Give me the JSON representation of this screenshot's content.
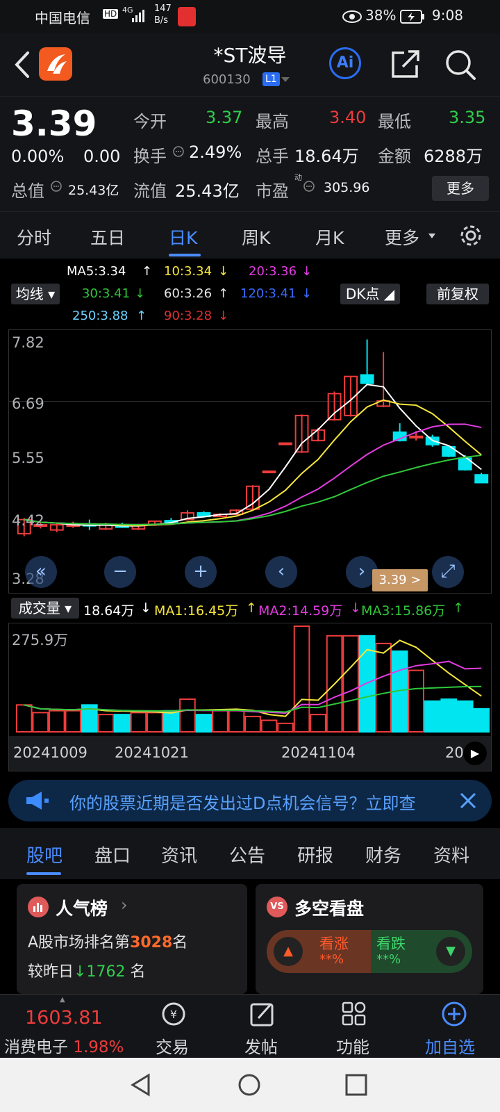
{
  "status_bar": {
    "carrier": "中国电信",
    "hd": "HD",
    "signal": "4G",
    "speed_value": "147",
    "speed_unit": "B/s",
    "battery": "38%",
    "time": "9:08"
  },
  "header": {
    "title": "*ST波导",
    "code": "600130",
    "level": "L1"
  },
  "quote": {
    "price": "3.39",
    "change_pct": "0.00%",
    "change": "0.00",
    "open_label": "今开",
    "open": "3.37",
    "high_label": "最高",
    "high": "3.40",
    "low_label": "最低",
    "low": "3.35",
    "turnover_label": "换手",
    "turnover": "2.49%",
    "volume_label": "总手",
    "volume": "18.64万",
    "amount_label": "金额",
    "amount": "6288万",
    "mcap_label": "总值",
    "mcap": "25.43亿",
    "float_label": "流值",
    "float": "25.43亿",
    "pe_label": "市盈",
    "pe_sup": "动",
    "pe": "305.96",
    "more": "更多"
  },
  "tabs": [
    "分时",
    "五日",
    "日K",
    "周K",
    "月K",
    "更多"
  ],
  "active_tab": 2,
  "ma_legend": {
    "ma5": "MA5:3.34",
    "ma10": "10:3.34",
    "ma20": "20:3.36",
    "ma30": "30:3.41",
    "ma60": "60:3.26",
    "ma120": "120:3.41",
    "ma250": "250:3.88",
    "ma90": "90:3.28",
    "ma_btn": "均线",
    "dk_btn": "DK点",
    "adj_btn": "前复权"
  },
  "colors": {
    "up": "#ee3c3c",
    "down": "#00e5f0",
    "ma5": "#ffffff",
    "ma10": "#f6e63c",
    "ma20": "#e23ce0",
    "ma30": "#30c73a",
    "ma60": "#e6e6e6",
    "ma120": "#3a6cff",
    "ma250": "#6ad1ff",
    "ma90": "#e03030"
  },
  "chart": {
    "y_labels": [
      "7.82",
      "6.69",
      "5.55",
      "4.42",
      "3.28"
    ],
    "last_price_tag": "3.39 >"
  },
  "chart_data": {
    "type": "candlestick",
    "ylim": [
      3.28,
      7.82
    ],
    "candles": [
      {
        "o": 4.15,
        "c": 4.42,
        "h": 4.45,
        "l": 4.1
      },
      {
        "o": 4.3,
        "c": 4.32,
        "h": 4.38,
        "l": 4.25
      },
      {
        "o": 4.22,
        "c": 4.32,
        "h": 4.35,
        "l": 4.18
      },
      {
        "o": 4.3,
        "c": 4.32,
        "h": 4.38,
        "l": 4.26
      },
      {
        "o": 4.33,
        "c": 4.3,
        "h": 4.42,
        "l": 4.22
      },
      {
        "o": 4.24,
        "c": 4.32,
        "h": 4.36,
        "l": 4.22
      },
      {
        "o": 4.3,
        "c": 4.28,
        "h": 4.36,
        "l": 4.26
      },
      {
        "o": 4.24,
        "c": 4.3,
        "h": 4.34,
        "l": 4.22
      },
      {
        "o": 4.32,
        "c": 4.39,
        "h": 4.4,
        "l": 4.3
      },
      {
        "o": 4.4,
        "c": 4.39,
        "h": 4.45,
        "l": 4.36
      },
      {
        "o": 4.42,
        "c": 4.55,
        "h": 4.6,
        "l": 4.4
      },
      {
        "o": 4.55,
        "c": 4.48,
        "h": 4.58,
        "l": 4.46
      },
      {
        "o": 4.48,
        "c": 4.52,
        "h": 4.54,
        "l": 4.47
      },
      {
        "o": 4.52,
        "c": 4.6,
        "h": 4.62,
        "l": 4.51
      },
      {
        "o": 4.62,
        "c": 5.06,
        "h": 5.08,
        "l": 4.6
      },
      {
        "o": 5.35,
        "c": 5.35,
        "h": 5.36,
        "l": 5.34
      },
      {
        "o": 5.89,
        "c": 5.89,
        "h": 5.9,
        "l": 5.88
      },
      {
        "o": 5.72,
        "c": 6.42,
        "h": 6.44,
        "l": 5.7
      },
      {
        "o": 5.94,
        "c": 6.14,
        "h": 6.18,
        "l": 5.92
      },
      {
        "o": 6.34,
        "c": 6.84,
        "h": 6.88,
        "l": 6.32
      },
      {
        "o": 6.42,
        "c": 7.17,
        "h": 7.18,
        "l": 6.4
      },
      {
        "o": 7.2,
        "c": 7.04,
        "h": 7.88,
        "l": 7.0
      },
      {
        "o": 6.6,
        "c": 6.7,
        "h": 7.64,
        "l": 6.58
      },
      {
        "o": 6.1,
        "c": 5.94,
        "h": 6.27,
        "l": 5.92
      },
      {
        "o": 6.0,
        "c": 6.02,
        "h": 6.12,
        "l": 5.94
      },
      {
        "o": 6.0,
        "c": 5.86,
        "h": 6.05,
        "l": 5.82
      },
      {
        "o": 5.82,
        "c": 5.64,
        "h": 5.84,
        "l": 5.62
      },
      {
        "o": 5.6,
        "c": 5.38,
        "h": 5.66,
        "l": 5.36
      },
      {
        "o": 5.28,
        "c": 5.13,
        "h": 5.32,
        "l": 5.12
      }
    ],
    "volume_max_label": "275.9万",
    "volumes": [
      70,
      50,
      55,
      55,
      70,
      45,
      45,
      50,
      50,
      55,
      85,
      45,
      55,
      55,
      40,
      30,
      22,
      275,
      45,
      250,
      250,
      250,
      230,
      210,
      160,
      80,
      85,
      80,
      60
    ]
  },
  "volume_legend": {
    "btn": "成交量",
    "vol": "18.64万",
    "ma1": "MA1:16.45万",
    "ma2": "MA2:14.59万",
    "ma3": "MA3:15.86万"
  },
  "dates": [
    "20241009",
    "20241021",
    "20241104",
    "20"
  ],
  "notice": "你的股票近期是否发出过D点机会信号？立即查",
  "bottom_tabs": [
    "股吧",
    "盘口",
    "资讯",
    "公告",
    "研报",
    "财务",
    "资料"
  ],
  "cards": {
    "popular_title": "人气榜",
    "rank_prefix": "A股市场排名第",
    "rank": "3028",
    "rank_suffix": "名",
    "cmp_prefix": "较昨日",
    "cmp_value": "1762",
    "cmp_suffix": "名",
    "duokong_title": "多空看盘",
    "up_label": "看涨",
    "up_value": "**%",
    "down_label": "看跌",
    "down_value": "**%"
  },
  "bottom_nav": {
    "index_value": "1603.81",
    "index_name": "消费电子",
    "index_pct": "1.98%",
    "trade": "交易",
    "post": "发帖",
    "func": "功能",
    "add": "加自选"
  }
}
